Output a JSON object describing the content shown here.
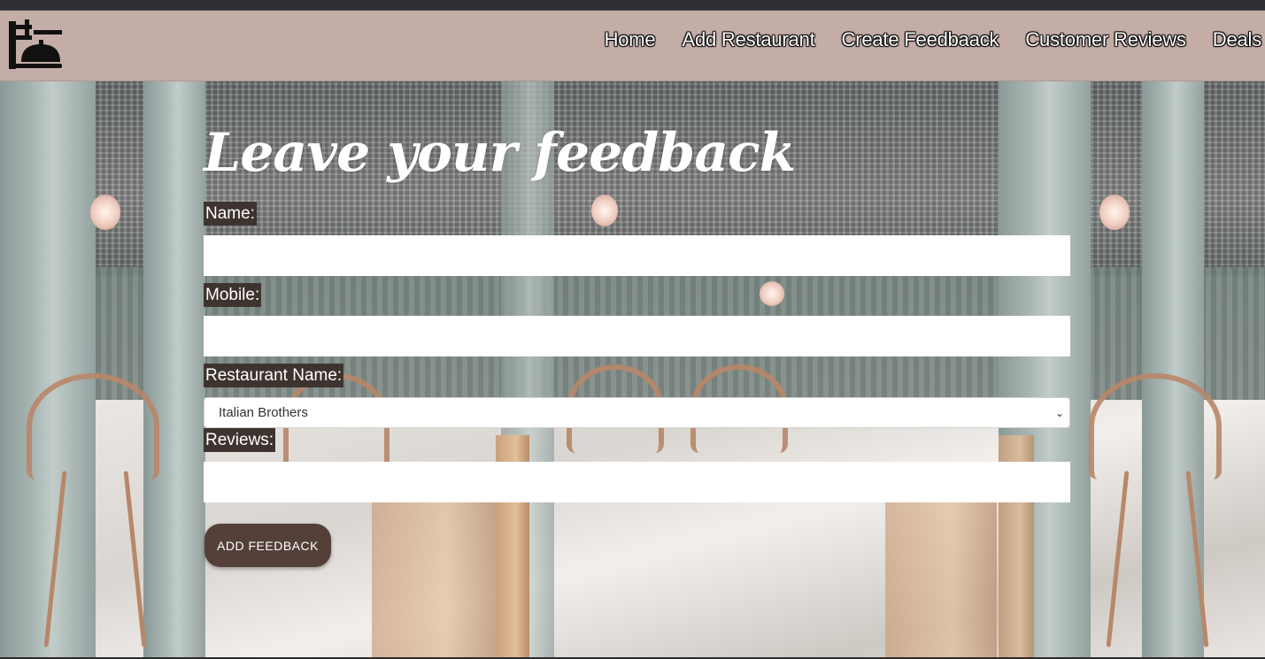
{
  "nav": {
    "logo_icon": "restaurant-dome-icon",
    "links": [
      {
        "label": "Home"
      },
      {
        "label": "Add Restaurant"
      },
      {
        "label": "Create Feedbaack"
      },
      {
        "label": "Customer Reviews"
      },
      {
        "label": "Deals"
      }
    ]
  },
  "form": {
    "title": "Leave your feedback",
    "name_label": "Name:",
    "name_value": "",
    "mobile_label": "Mobile:",
    "mobile_value": "",
    "restaurant_label": "Restaurant Name:",
    "restaurant_selected": "Italian Brothers",
    "reviews_label": "Reviews:",
    "reviews_value": "",
    "submit_label": "ADD FEEDBACK"
  },
  "colors": {
    "navbar": "#c3ada6",
    "label_bg": "#3e342f",
    "button": "#544039"
  }
}
